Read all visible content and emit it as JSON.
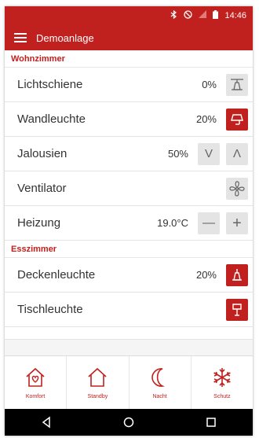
{
  "status_bar": {
    "time": "14:46",
    "icons": [
      "bluetooth-icon",
      "do-not-disturb-icon",
      "signal-icon",
      "battery-icon"
    ]
  },
  "app_bar": {
    "title": "Demoanlage",
    "menu_icon": "hamburger-menu-icon"
  },
  "sections": [
    {
      "title": "Wohnzimmer",
      "rows": [
        {
          "label": "Lichtschiene",
          "value": "0%"
        },
        {
          "label": "Wandleuchte",
          "value": "20%"
        },
        {
          "label": "Jalousien",
          "value": "50%",
          "down_label": "V",
          "up_label": "Λ"
        },
        {
          "label": "Ventilator",
          "value": ""
        },
        {
          "label": "Heizung",
          "value": "19.0°C",
          "minus_label": "—",
          "plus_label": "+"
        }
      ]
    },
    {
      "title": "Esszimmer",
      "rows": [
        {
          "label": "Deckenleuchte",
          "value": "20%"
        },
        {
          "label": "Tischleuchte",
          "value": ""
        }
      ]
    }
  ],
  "bottom_tabs": [
    {
      "label": "Komfort",
      "icon": "house-heart-icon"
    },
    {
      "label": "Standby",
      "icon": "house-icon"
    },
    {
      "label": "Nacht",
      "icon": "moon-icon"
    },
    {
      "label": "Schutz",
      "icon": "snowflake-icon"
    }
  ],
  "nav_bar": {
    "icons": [
      "back-icon",
      "home-icon",
      "recents-icon"
    ]
  },
  "colors": {
    "accent": "#c0201e",
    "button_off": "#e4e4e4",
    "background": "#f5f5f5"
  }
}
